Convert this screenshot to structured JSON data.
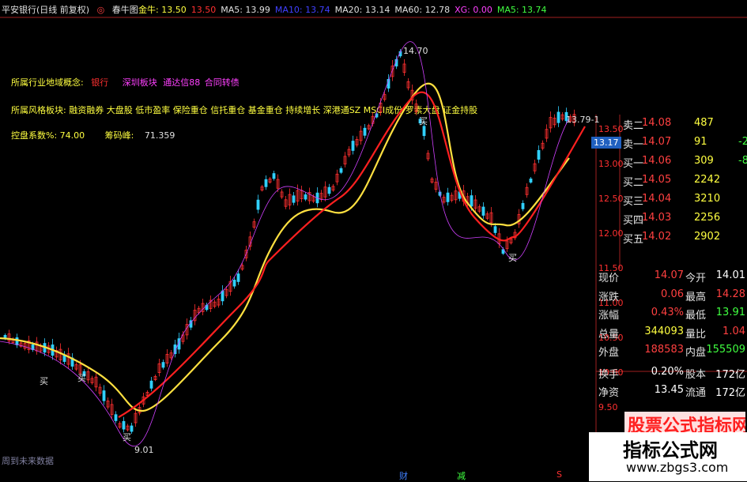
{
  "header": {
    "title": "平安银行(日线 前复权)",
    "icon_label": "春牛图",
    "items": [
      {
        "label": "金牛: 13.50",
        "color": "#ffff40"
      },
      {
        "label": "13.50",
        "color": "#ff3030"
      },
      {
        "label": "MA5: 13.99",
        "color": "#e0e0e0"
      },
      {
        "label": "MA10: 13.74",
        "color": "#4040ff"
      },
      {
        "label": "MA20: 13.14",
        "color": "#e0e0e0"
      },
      {
        "label": "MA60: 12.78",
        "color": "#e0e0e0"
      },
      {
        "label": "XG: 0.00",
        "color": "#ff40ff"
      },
      {
        "label": "MA5: 13.74",
        "color": "#40ff40"
      }
    ]
  },
  "info": {
    "industry_label": "所属行业地域概念:",
    "industry_values": [
      "银行",
      "深圳板块",
      "通达信88",
      "合同转债"
    ],
    "style_label": "所属风格板块:",
    "style_values": "融资融券 大盘股 低市盈率 保险重仓 信托重仓 基金重仓 持续增长 深港通SZ MSCI成份 罗素大盘 证金持股",
    "control_label": "控盘系数%: 74.00",
    "chip_label": "筹码峰:",
    "chip_value": "71.359"
  },
  "chart_annotations": {
    "high": "14.70",
    "low": "9.01",
    "last_marker": "13.79-1",
    "footer": "周到未来数据",
    "buy_labels": [
      "买",
      "买",
      "买",
      "买",
      "买"
    ],
    "sell_labels": [
      "卖",
      "卖"
    ],
    "bottom_letters": [
      "财",
      "减",
      "S"
    ]
  },
  "price_axis": {
    "ticks": [
      "13.50",
      "13.00",
      "12.50",
      "12.00",
      "11.50",
      "11.00",
      "10.50",
      "10.00",
      "9.50"
    ],
    "current": "13.17"
  },
  "order_book": [
    {
      "label": "卖二",
      "price": "14.08",
      "volume": "487",
      "change": ""
    },
    {
      "label": "卖一",
      "price": "14.07",
      "volume": "91",
      "change": "-2"
    },
    {
      "label": "买一",
      "price": "14.06",
      "volume": "309",
      "change": "-8"
    },
    {
      "label": "买二",
      "price": "14.05",
      "volume": "2242",
      "change": ""
    },
    {
      "label": "买三",
      "price": "14.04",
      "volume": "3210",
      "change": ""
    },
    {
      "label": "买四",
      "price": "14.03",
      "volume": "2256",
      "change": ""
    },
    {
      "label": "买五",
      "price": "14.02",
      "volume": "2902",
      "change": ""
    }
  ],
  "stats": [
    {
      "l1": "现价",
      "v1": "14.07",
      "c1": "#ff4040",
      "l2": "今开",
      "v2": "14.01",
      "c2": "#ffffff"
    },
    {
      "l1": "涨跌",
      "v1": "0.06",
      "c1": "#ff4040",
      "l2": "最高",
      "v2": "14.28",
      "c2": "#ff4040"
    },
    {
      "l1": "涨幅",
      "v1": "0.43%",
      "c1": "#ff4040",
      "l2": "最低",
      "v2": "13.91",
      "c2": "#40ff40"
    },
    {
      "l1": "总量",
      "v1": "344093",
      "c1": "#ffff40",
      "l2": "量比",
      "v2": "1.04",
      "c2": "#ff4040"
    },
    {
      "l1": "外盘",
      "v1": "188583",
      "c1": "#ff4040",
      "l2": "内盘",
      "v2": "155509",
      "c2": "#40ff40"
    },
    {
      "l1": "换手",
      "v1": "0.20%",
      "c1": "#ffffff",
      "l2": "股本",
      "v2": "172亿",
      "c2": "#ffffff"
    },
    {
      "l1": "净资",
      "v1": "13.45",
      "c1": "#ffffff",
      "l2": "流通",
      "v2": "172亿",
      "c2": "#ffffff"
    }
  ],
  "watermark": {
    "banner": "股票公式指标网",
    "line1": "指标公式网",
    "line2": "www.zbgs3.com"
  },
  "colors": {
    "up": "#ff3030",
    "down": "#30d0ff",
    "ma_yellow": "#ffe040",
    "ma_red": "#ff2020",
    "purple": "#d040ff",
    "green_text": "#40ff40"
  }
}
